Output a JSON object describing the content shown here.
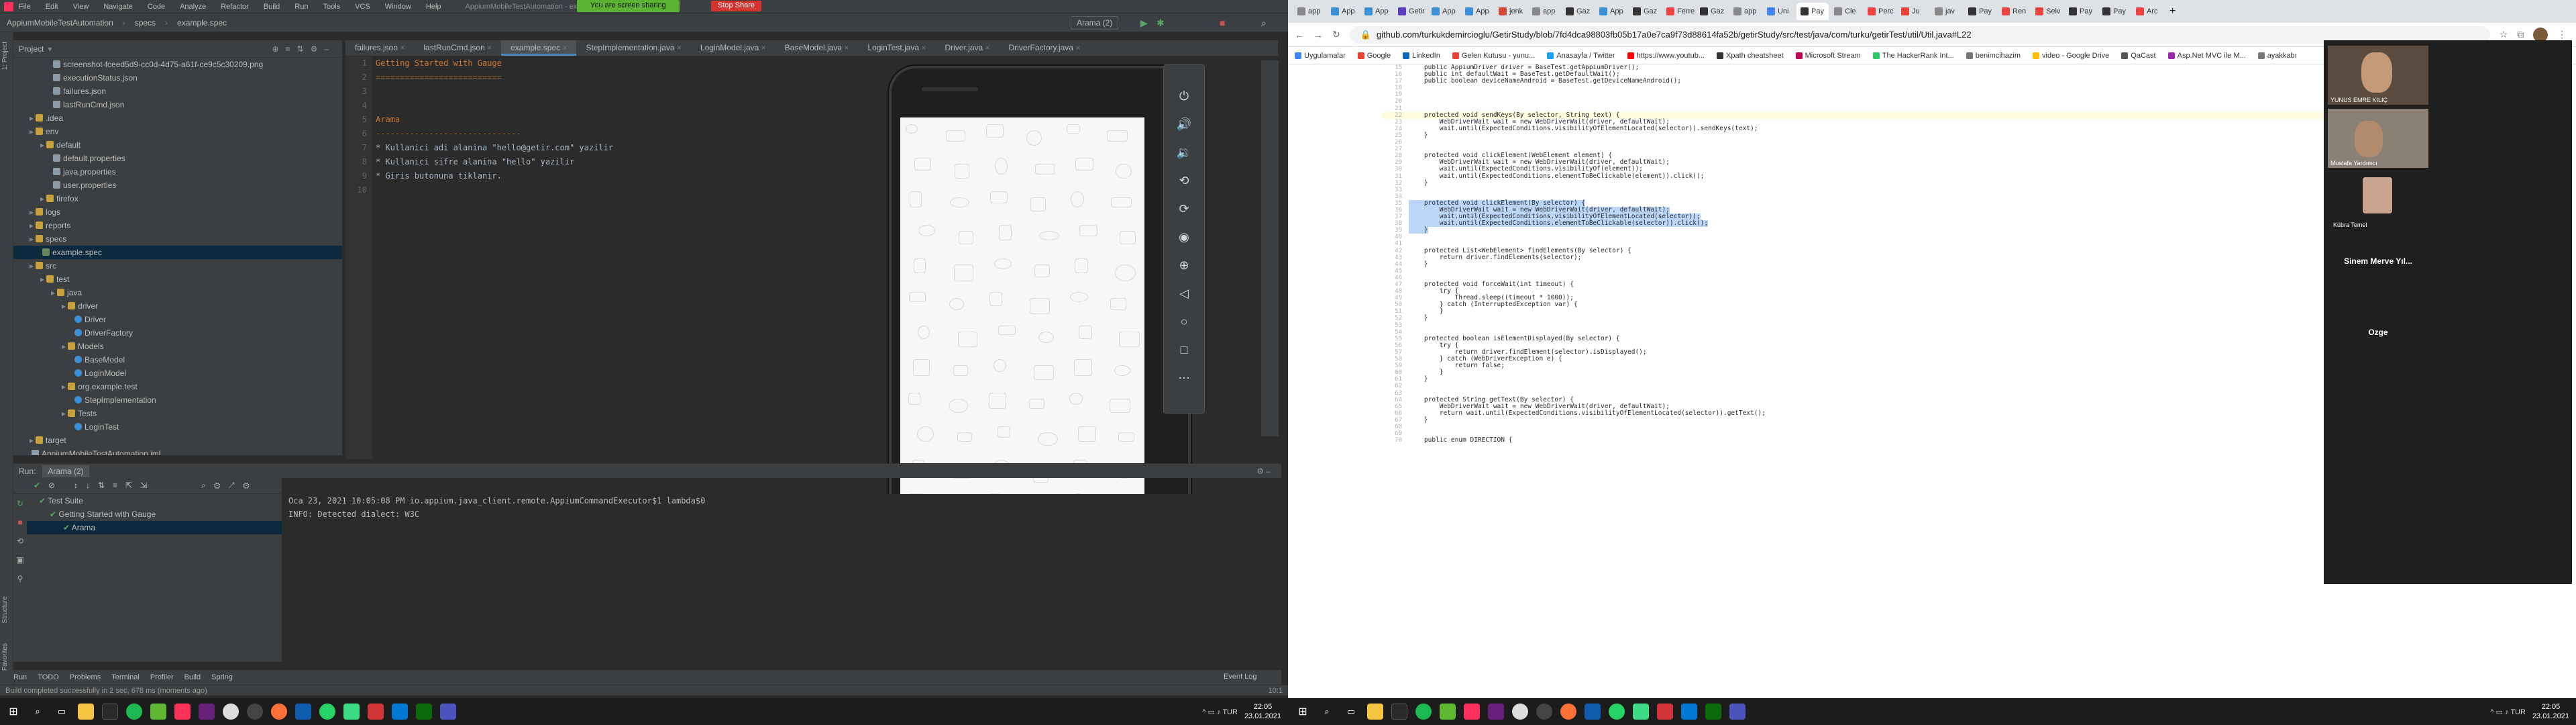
{
  "ide": {
    "window_title": "AppiumMobileTestAutomation - example.spec",
    "menu": [
      "File",
      "Edit",
      "View",
      "Navigate",
      "Code",
      "Analyze",
      "Refactor",
      "Build",
      "Run",
      "Tools",
      "VCS",
      "Window",
      "Help"
    ],
    "share_banner": "You are screen sharing",
    "stop_share": "Stop Share",
    "breadcrumbs": [
      "AppiumMobileTestAutomation",
      "specs",
      "example.spec"
    ],
    "run_config": "Arama (2)",
    "project_label": "Project",
    "tree": [
      {
        "label": "screenshot-fceed5d9-cc0d-4d75-a61f-ce9c5c30209.png",
        "indent": 3,
        "icon": "file",
        "sel": false
      },
      {
        "label": "executionStatus.json",
        "indent": 3,
        "icon": "file",
        "sel": false
      },
      {
        "label": "failures.json",
        "indent": 3,
        "icon": "file",
        "sel": false
      },
      {
        "label": "lastRunCmd.json",
        "indent": 3,
        "icon": "file",
        "sel": false
      },
      {
        "label": ".idea",
        "indent": 1,
        "icon": "fold",
        "sel": false
      },
      {
        "label": "env",
        "indent": 1,
        "icon": "fold",
        "sel": false
      },
      {
        "label": "default",
        "indent": 2,
        "icon": "fold",
        "sel": false
      },
      {
        "label": "default.properties",
        "indent": 3,
        "icon": "file",
        "sel": false
      },
      {
        "label": "java.properties",
        "indent": 3,
        "icon": "file",
        "sel": false
      },
      {
        "label": "user.properties",
        "indent": 3,
        "icon": "file",
        "sel": false
      },
      {
        "label": "firefox",
        "indent": 2,
        "icon": "fold",
        "sel": false
      },
      {
        "label": "logs",
        "indent": 1,
        "icon": "fold",
        "sel": false
      },
      {
        "label": "reports",
        "indent": 1,
        "icon": "fold",
        "sel": false
      },
      {
        "label": "specs",
        "indent": 1,
        "icon": "fold",
        "sel": false
      },
      {
        "label": "example.spec",
        "indent": 2,
        "icon": "spec",
        "sel": true
      },
      {
        "label": "src",
        "indent": 1,
        "icon": "fold",
        "sel": false
      },
      {
        "label": "test",
        "indent": 2,
        "icon": "fold",
        "sel": false
      },
      {
        "label": "java",
        "indent": 3,
        "icon": "fold",
        "sel": false
      },
      {
        "label": "driver",
        "indent": 4,
        "icon": "fold",
        "sel": false
      },
      {
        "label": "Driver",
        "indent": 5,
        "icon": "java",
        "sel": false
      },
      {
        "label": "DriverFactory",
        "indent": 5,
        "icon": "java",
        "sel": false
      },
      {
        "label": "Models",
        "indent": 4,
        "icon": "fold",
        "sel": false
      },
      {
        "label": "BaseModel",
        "indent": 5,
        "icon": "java",
        "sel": false
      },
      {
        "label": "LoginModel",
        "indent": 5,
        "icon": "java",
        "sel": false
      },
      {
        "label": "org.example.test",
        "indent": 4,
        "icon": "fold",
        "sel": false
      },
      {
        "label": "StepImplementation",
        "indent": 5,
        "icon": "java",
        "sel": false
      },
      {
        "label": "Tests",
        "indent": 4,
        "icon": "fold",
        "sel": false
      },
      {
        "label": "LoginTest",
        "indent": 5,
        "icon": "java",
        "sel": false
      },
      {
        "label": "target",
        "indent": 1,
        "icon": "fold",
        "sel": false
      },
      {
        "label": "AppiumMobileTestAutomation.iml",
        "indent": 1,
        "icon": "file",
        "sel": false
      }
    ],
    "tabs": [
      "failures.json",
      "lastRunCmd.json",
      "example.spec",
      "StepImplementation.java",
      "LoginModel.java",
      "BaseModel.java",
      "LoginTest.java",
      "Driver.java",
      "DriverFactory.java"
    ],
    "active_tab": "example.spec",
    "code": [
      {
        "n": "1",
        "t": "Getting Started with Gauge",
        "c": "c-head"
      },
      {
        "n": "2",
        "t": "==========================",
        "c": "c-line"
      },
      {
        "n": "3",
        "t": "",
        "c": "c-txt"
      },
      {
        "n": "4",
        "t": "",
        "c": "c-txt"
      },
      {
        "n": "5",
        "t": "Arama",
        "c": "c-head"
      },
      {
        "n": "6",
        "t": "------------------------------",
        "c": "c-line"
      },
      {
        "n": "7",
        "t": "* Kullanici adi alanina \"hello@getir.com\" yazilir",
        "c": "c-txt"
      },
      {
        "n": "8",
        "t": "* Kullanici sifre alanina \"hello\" yazilir",
        "c": "c-txt"
      },
      {
        "n": "9",
        "t": "* Giris butonuna tiklanir.",
        "c": "c-txt"
      },
      {
        "n": "10",
        "t": "",
        "c": "c-txt"
      }
    ],
    "run_tab": "Run:",
    "run_name": "Arama (2)",
    "run_tree": [
      "Test Suite",
      "Getting Started with Gauge",
      "Arama"
    ],
    "console": [
      "Oca 23, 2021 10:05:08 PM io.appium.java_client.remote.AppiumCommandExecutor$1 lambda$0",
      "INFO: Detected dialect: W3C"
    ],
    "bottom_tabs": [
      "Run",
      "TODO",
      "Problems",
      "Terminal",
      "Profiler",
      "Build",
      "Spring"
    ],
    "event_log": "Event Log",
    "status_left": "Build completed successfully in 2 sec, 678 ms (moments ago)",
    "status_right": "10:1"
  },
  "taskbar_left": {
    "time": "22:05",
    "date": "23.01.2021"
  },
  "browser": {
    "tabs": [
      "app",
      "App",
      "App",
      "Getir",
      "App",
      "App",
      "jenk",
      "app",
      "Gaz",
      "App",
      "Gaz",
      "Ferrebr",
      "Gaz",
      "app",
      "Uni",
      "Pay",
      "Cle",
      "Perc",
      "Ju",
      "jav",
      "Pay",
      "Ren",
      "Selv",
      "Pay",
      "Pay",
      "Arc"
    ],
    "active_tab_index": 15,
    "url": "github.com/turkukdemircioglu/GetirStudy/blob/7fd4dca98803fb05b17a0e7ca9f73d88614fa52b/getirStudy/src/test/java/com/turku/getirTest/util/Util.java#L22",
    "bookmarks": [
      {
        "label": "Uygulamalar",
        "color": "#4285f4"
      },
      {
        "label": "Google",
        "color": "#ea4335"
      },
      {
        "label": "LinkedIn",
        "color": "#0a66c2"
      },
      {
        "label": "Gelen Kutusu - yunu...",
        "color": "#ea4335"
      },
      {
        "label": "Anasayfa / Twitter",
        "color": "#1da1f2"
      },
      {
        "label": "https://www.youtub...",
        "color": "#ff0000"
      },
      {
        "label": "Xpath cheatsheet",
        "color": "#333"
      },
      {
        "label": "Microsoft Stream",
        "color": "#c30052"
      },
      {
        "label": "The HackerRank Int...",
        "color": "#2ec866"
      },
      {
        "label": "benimcihazim",
        "color": "#777"
      },
      {
        "label": "video - Google Drive",
        "color": "#fbbc04"
      },
      {
        "label": "QaCast",
        "color": "#555"
      },
      {
        "label": "Asp.Net MVC ile M...",
        "color": "#9c27b0"
      },
      {
        "label": "ayakkabı",
        "color": "#777"
      }
    ],
    "code_lines": [
      {
        "n": "15",
        "t": "    public AppiumDriver driver = BaseTest.getAppiumDriver();",
        "hl": false,
        "sel": false
      },
      {
        "n": "16",
        "t": "    public int defaultWait = BaseTest.getDefaultWait();",
        "hl": false,
        "sel": false
      },
      {
        "n": "17",
        "t": "    public boolean deviceNameAndroid = BaseTest.getDeviceNameAndroid();",
        "hl": false,
        "sel": false
      },
      {
        "n": "18",
        "t": "",
        "hl": false,
        "sel": false
      },
      {
        "n": "19",
        "t": "",
        "hl": false,
        "sel": false
      },
      {
        "n": "20",
        "t": "",
        "hl": false,
        "sel": false
      },
      {
        "n": "21",
        "t": "",
        "hl": false,
        "sel": false
      },
      {
        "n": "22",
        "t": "    protected void sendKeys(By selector, String text) {",
        "hl": true,
        "sel": false
      },
      {
        "n": "23",
        "t": "        WebDriverWait wait = new WebDriverWait(driver, defaultWait);",
        "hl": false,
        "sel": false
      },
      {
        "n": "24",
        "t": "        wait.until(ExpectedConditions.visibilityOfElementLocated(selector)).sendKeys(text);",
        "hl": false,
        "sel": false
      },
      {
        "n": "25",
        "t": "    }",
        "hl": false,
        "sel": false
      },
      {
        "n": "26",
        "t": "",
        "hl": false,
        "sel": false
      },
      {
        "n": "27",
        "t": "",
        "hl": false,
        "sel": false
      },
      {
        "n": "28",
        "t": "    protected void clickElement(WebElement element) {",
        "hl": false,
        "sel": false
      },
      {
        "n": "29",
        "t": "        WebDriverWait wait = new WebDriverWait(driver, defaultWait);",
        "hl": false,
        "sel": false
      },
      {
        "n": "30",
        "t": "        wait.until(ExpectedConditions.visibilityOf(element));",
        "hl": false,
        "sel": false
      },
      {
        "n": "31",
        "t": "        wait.until(ExpectedConditions.elementToBeClickable(element)).click();",
        "hl": false,
        "sel": false
      },
      {
        "n": "32",
        "t": "    }",
        "hl": false,
        "sel": false
      },
      {
        "n": "33",
        "t": "",
        "hl": false,
        "sel": false
      },
      {
        "n": "34",
        "t": "",
        "hl": false,
        "sel": false
      },
      {
        "n": "35",
        "t": "    protected void clickElement(By selector) {",
        "hl": false,
        "sel": true
      },
      {
        "n": "36",
        "t": "        WebDriverWait wait = new WebDriverWait(driver, defaultWait);",
        "hl": false,
        "sel": true
      },
      {
        "n": "37",
        "t": "        wait.until(ExpectedConditions.visibilityOfElementLocated(selector));",
        "hl": false,
        "sel": true
      },
      {
        "n": "38",
        "t": "        wait.until(ExpectedConditions.elementToBeClickable(selector)).click();",
        "hl": false,
        "sel": true
      },
      {
        "n": "39",
        "t": "    }",
        "hl": false,
        "sel": true
      },
      {
        "n": "40",
        "t": "",
        "hl": false,
        "sel": false
      },
      {
        "n": "41",
        "t": "",
        "hl": false,
        "sel": false
      },
      {
        "n": "42",
        "t": "    protected List<WebElement> findElements(By selector) {",
        "hl": false,
        "sel": false
      },
      {
        "n": "43",
        "t": "        return driver.findElements(selector);",
        "hl": false,
        "sel": false
      },
      {
        "n": "44",
        "t": "    }",
        "hl": false,
        "sel": false
      },
      {
        "n": "45",
        "t": "",
        "hl": false,
        "sel": false
      },
      {
        "n": "46",
        "t": "",
        "hl": false,
        "sel": false
      },
      {
        "n": "47",
        "t": "    protected void forceWait(int timeout) {",
        "hl": false,
        "sel": false
      },
      {
        "n": "48",
        "t": "        try {",
        "hl": false,
        "sel": false
      },
      {
        "n": "49",
        "t": "            Thread.sleep((timeout * 1000));",
        "hl": false,
        "sel": false
      },
      {
        "n": "50",
        "t": "        } catch (InterruptedException var) {",
        "hl": false,
        "sel": false
      },
      {
        "n": "51",
        "t": "        }",
        "hl": false,
        "sel": false
      },
      {
        "n": "52",
        "t": "    }",
        "hl": false,
        "sel": false
      },
      {
        "n": "53",
        "t": "",
        "hl": false,
        "sel": false
      },
      {
        "n": "54",
        "t": "",
        "hl": false,
        "sel": false
      },
      {
        "n": "55",
        "t": "    protected boolean isElementDisplayed(By selector) {",
        "hl": false,
        "sel": false
      },
      {
        "n": "56",
        "t": "        try {",
        "hl": false,
        "sel": false
      },
      {
        "n": "57",
        "t": "            return driver.findElement(selector).isDisplayed();",
        "hl": false,
        "sel": false
      },
      {
        "n": "58",
        "t": "        } catch (WebDriverException e) {",
        "hl": false,
        "sel": false
      },
      {
        "n": "59",
        "t": "            return false;",
        "hl": false,
        "sel": false
      },
      {
        "n": "60",
        "t": "        }",
        "hl": false,
        "sel": false
      },
      {
        "n": "61",
        "t": "    }",
        "hl": false,
        "sel": false
      },
      {
        "n": "62",
        "t": "",
        "hl": false,
        "sel": false
      },
      {
        "n": "63",
        "t": "",
        "hl": false,
        "sel": false
      },
      {
        "n": "64",
        "t": "    protected String getText(By selector) {",
        "hl": false,
        "sel": false
      },
      {
        "n": "65",
        "t": "        WebDriverWait wait = new WebDriverWait(driver, defaultWait);",
        "hl": false,
        "sel": false
      },
      {
        "n": "66",
        "t": "        return wait.until(ExpectedConditions.visibilityOfElementLocated(selector)).getText();",
        "hl": false,
        "sel": false
      },
      {
        "n": "67",
        "t": "    }",
        "hl": false,
        "sel": false
      },
      {
        "n": "68",
        "t": "",
        "hl": false,
        "sel": false
      },
      {
        "n": "69",
        "t": "",
        "hl": false,
        "sel": false
      },
      {
        "n": "70",
        "t": "    public enum DIRECTION {",
        "hl": false,
        "sel": false
      }
    ],
    "participants": [
      {
        "name": "YUNUS EMRE KILIÇ",
        "type": "video"
      },
      {
        "name": "Mustafa Yardımcı",
        "type": "video"
      },
      {
        "name": "Kübra Temel",
        "type": "avatar"
      },
      {
        "name": "Sinem Merve Yıl...",
        "type": "text"
      },
      {
        "name": "Ozge",
        "type": "text"
      }
    ]
  },
  "taskbar_right": {
    "time": "22:05",
    "date": "23.01.2021"
  }
}
